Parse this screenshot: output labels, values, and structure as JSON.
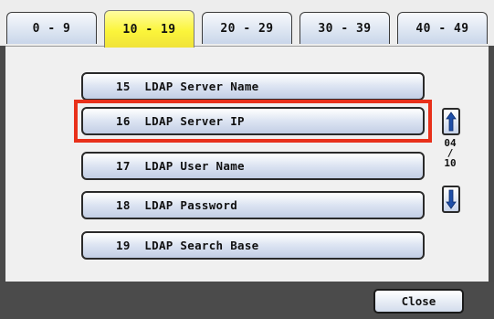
{
  "tabs": [
    {
      "label": "0 - 9",
      "active": false
    },
    {
      "label": "10 - 19",
      "active": true
    },
    {
      "label": "20 - 29",
      "active": false
    },
    {
      "label": "30 - 39",
      "active": false
    },
    {
      "label": "40 - 49",
      "active": false
    }
  ],
  "items": [
    {
      "label": "15  LDAP Server Name"
    },
    {
      "label": "16  LDAP Server IP",
      "selected": true
    },
    {
      "label": "17  LDAP User Name"
    },
    {
      "label": "18  LDAP Password"
    },
    {
      "label": "19  LDAP Search Base"
    }
  ],
  "pager": {
    "current": "04",
    "separator": "/",
    "total": "10"
  },
  "scroll": {
    "up_icon": "arrow-up-icon",
    "down_icon": "arrow-down-icon"
  },
  "footer": {
    "close_label": "Close"
  },
  "colors": {
    "active_tab": "#fbf53a",
    "tab": "#c9d6ea",
    "highlight": "#e8301a",
    "panel": "#f0f0f0",
    "footer": "#4b4b4b"
  }
}
